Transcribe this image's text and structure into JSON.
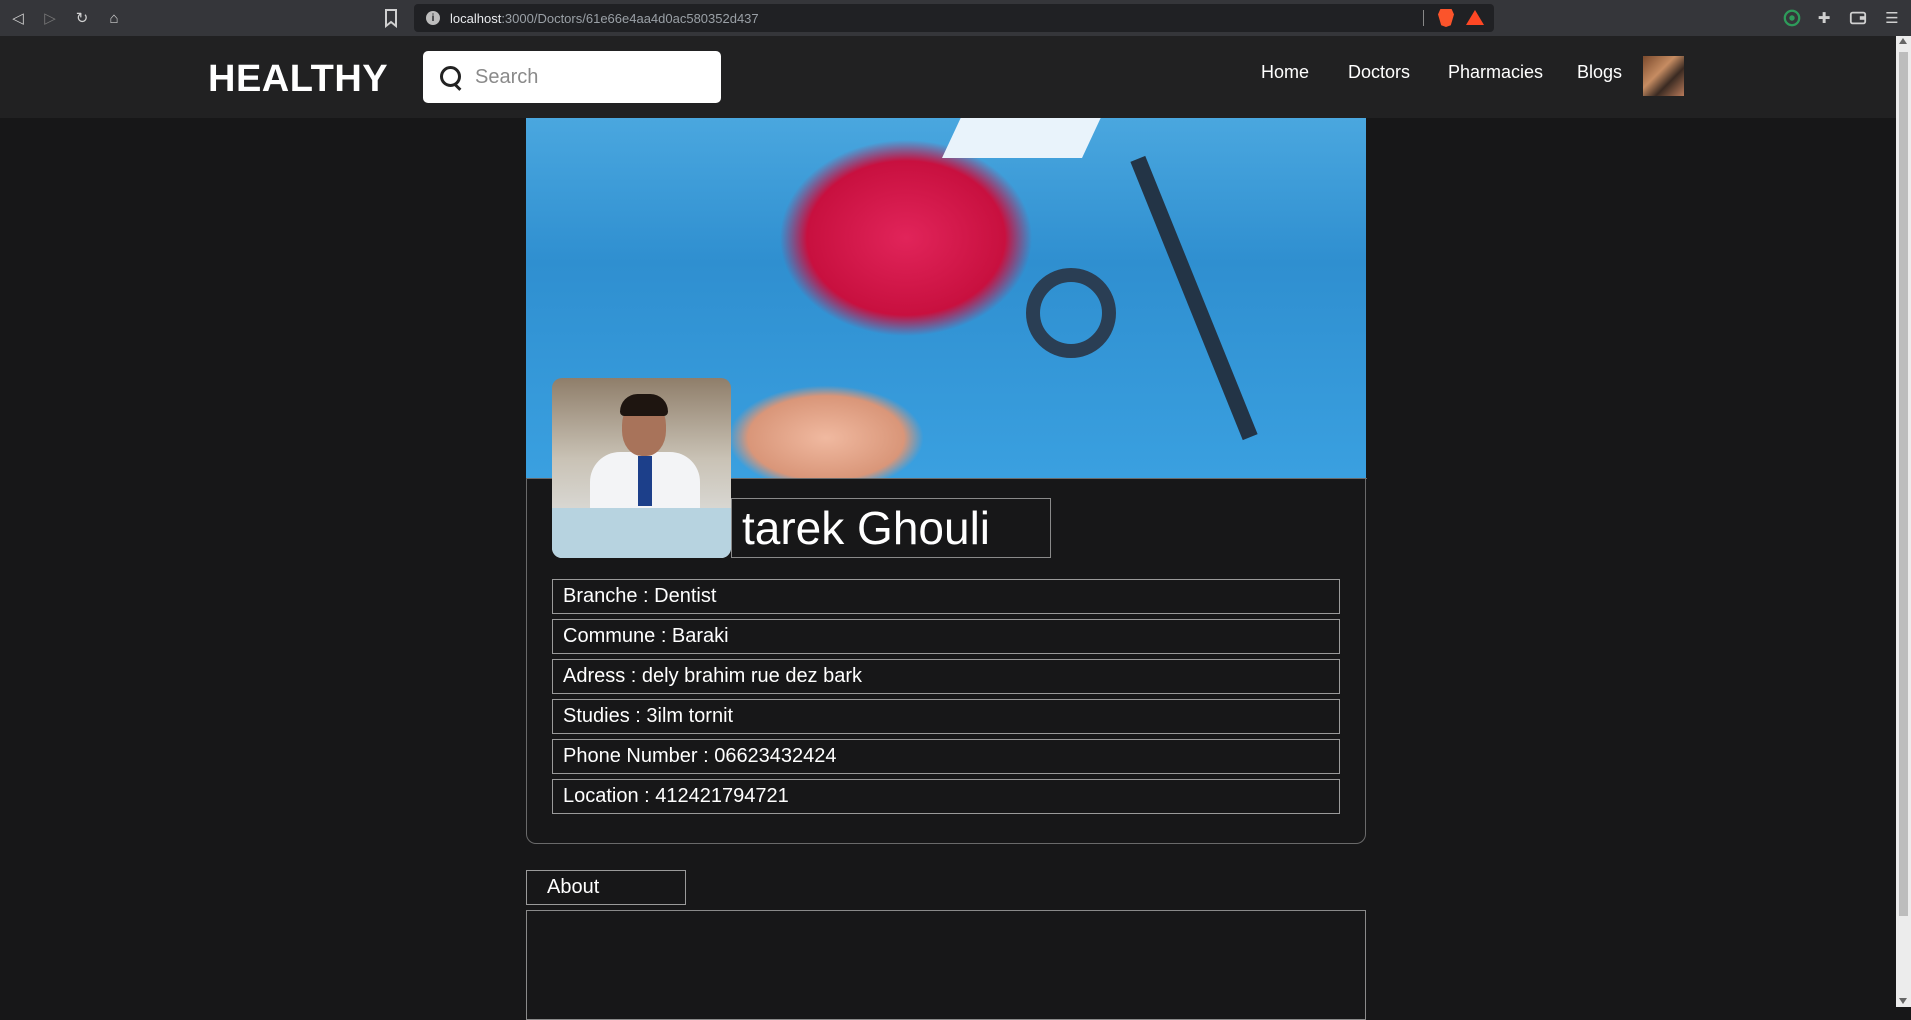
{
  "browser": {
    "url_host": "localhost",
    "url_path": ":3000/Doctors/61e66e4aa4d0ac580352d437",
    "icons": [
      "back-icon",
      "forward-icon",
      "reload-icon",
      "home-icon",
      "bookmark-icon",
      "site-info-icon",
      "brave-shield-icon",
      "brave-rewards-icon",
      "extension-icon",
      "puzzle-icon",
      "wallet-icon",
      "menu-icon"
    ]
  },
  "header": {
    "logo": "HEALTHY",
    "search_placeholder": "Search",
    "nav": [
      "Home",
      "Doctors",
      "Pharmacies",
      "Blogs"
    ]
  },
  "doctor": {
    "name": "tarek Ghouli",
    "branche": "Branche : Dentist",
    "commune": "Commune : Baraki",
    "adress": "Adress : dely brahim rue dez bark",
    "studies": "Studies : 3ilm tornit",
    "phone": "Phone Number : 06623432424",
    "location": "Location : 412421794721"
  },
  "about": {
    "tab_label": "About",
    "content": ""
  },
  "colors": {
    "page_bg": "#171718",
    "header_bg": "#212122",
    "border": "#9a9a9a",
    "text": "#ffffff"
  }
}
